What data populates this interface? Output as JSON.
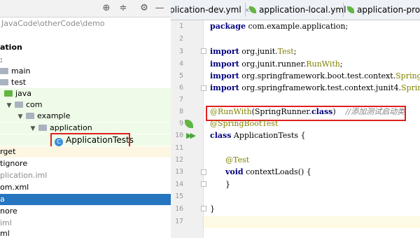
{
  "project": {
    "path": "JavaCode\\otherCode\\demo",
    "items": [
      {
        "label": "ation",
        "style": "bold"
      },
      {
        "label": ":",
        "style": "plain"
      },
      {
        "label": "main",
        "style": "folder"
      },
      {
        "label": "test",
        "style": "folder"
      },
      {
        "label": "java",
        "style": "green-folder"
      },
      {
        "label": "com",
        "style": "package"
      },
      {
        "label": "example",
        "style": "package"
      },
      {
        "label": "application",
        "style": "package"
      },
      {
        "label": "ApplicationTests",
        "style": "class"
      },
      {
        "label": "rget",
        "style": "plain"
      },
      {
        "label": "tignore",
        "style": "plain"
      },
      {
        "label": "plication.iml",
        "style": "gray"
      },
      {
        "label": "om.xml",
        "style": "plain"
      },
      {
        "label": "a",
        "style": "selected"
      },
      {
        "label": "nore",
        "style": "plain"
      },
      {
        "label": "iml",
        "style": "gray"
      },
      {
        "label": "ml",
        "style": "plain"
      }
    ]
  },
  "toolbar": {
    "icons": [
      "crosshair-icon",
      "collapse-icon",
      "gear-icon",
      "minimize-icon"
    ]
  },
  "tabs": [
    {
      "label": "plication-dev.yml"
    },
    {
      "label": "application-local.yml"
    },
    {
      "label": "application-prod.ym"
    }
  ],
  "editor": {
    "line_numbers": [
      "1",
      "2",
      "3",
      "4",
      "5",
      "6",
      "7",
      "8",
      "9",
      "10",
      "11",
      "12",
      "13",
      "14",
      "15",
      "16",
      "17"
    ],
    "lines": {
      "l1": {
        "kw": "package",
        "rest": " com.example.application;"
      },
      "l3": {
        "kw": "import",
        "pkg": " org.junit.",
        "cls": "Test",
        "end": ";"
      },
      "l4": {
        "kw": "import",
        "pkg": " org.junit.runner.",
        "cls": "RunWith",
        "end": ";"
      },
      "l5": {
        "kw": "import",
        "pkg": " org.springframework.boot.test.context.",
        "cls": "SpringBoo"
      },
      "l6": {
        "kw": "import",
        "pkg": " org.springframework.test.context.junit4.",
        "cls": "SpringR"
      },
      "l8": {
        "ann": "@RunWith",
        "mid": "(SpringRunner.",
        "kw": "class",
        "end": ")",
        "comment": "//添加测试启动类"
      },
      "l9": {
        "ann": "@SpringBootTest"
      },
      "l10": {
        "kw": "class",
        "rest": " ApplicationTests {"
      },
      "l12": {
        "ann": "@Test"
      },
      "l13": {
        "kw": "void",
        "rest": " contextLoads() {"
      },
      "l14": {
        "rest": "}"
      },
      "l16": {
        "rest": "}"
      }
    }
  },
  "colors": {
    "highlight": "#e02020",
    "selection": "#2675bf",
    "test_bg": "#eefbe8"
  }
}
